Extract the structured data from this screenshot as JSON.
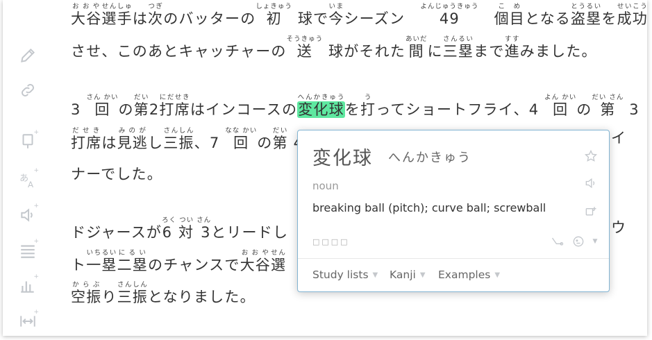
{
  "article": {
    "p1": {
      "l1": [
        {
          "t": "大谷",
          "r": "おおや"
        },
        {
          "t": "選手",
          "r": "せんしゅ"
        },
        {
          "t": "は"
        },
        {
          "t": "次",
          "r": "つぎ"
        },
        {
          "t": "のバッターの"
        },
        {
          "t": "初",
          "r": "しょきゅう"
        },
        {
          "t": " "
        },
        {
          "t": "球",
          "r": ""
        },
        {
          "t": "で"
        },
        {
          "t": "今",
          "r": "いま"
        },
        {
          "t": "シーズン　"
        },
        {
          "t": "49",
          "r": "よんじゅうきゅう"
        },
        {
          "t": "　"
        },
        {
          "t": "個",
          "r": "こ"
        },
        {
          "t": "目",
          "r": "め"
        },
        {
          "t": "となる"
        },
        {
          "t": "盗塁",
          "r": "とうるい"
        },
        {
          "t": "を"
        },
        {
          "t": "成功",
          "r": "せいこう"
        }
      ],
      "l2": [
        {
          "t": "させ、このあとキャッチャーの"
        },
        {
          "t": "送",
          "r": "そうきゅう"
        },
        {
          "t": " "
        },
        {
          "t": "球",
          "r": ""
        },
        {
          "t": "がそれた"
        },
        {
          "t": "間",
          "r": "あいだ"
        },
        {
          "t": "に"
        },
        {
          "t": "三塁",
          "r": "さんるい"
        },
        {
          "t": "まで"
        },
        {
          "t": "進",
          "r": "すす"
        },
        {
          "t": "みました。"
        }
      ]
    },
    "p2": {
      "l1": [
        {
          "t": " 3 "
        },
        {
          "t": "回",
          "r": "さん かい"
        },
        {
          "t": "の"
        },
        {
          "t": "第",
          "r": "だい"
        },
        {
          "t": "2"
        },
        {
          "t": "打席",
          "r": "にだせき"
        },
        {
          "t": "はインコースの"
        },
        {
          "t": "変化球",
          "r": "へんかきゅう",
          "hl": true
        },
        {
          "t": "を"
        },
        {
          "t": "打",
          "r": "う"
        },
        {
          "t": "ってショートフライ、4 "
        },
        {
          "t": "回",
          "r": "よん かい"
        },
        {
          "t": "の"
        },
        {
          "t": "第",
          "r": "だい さん"
        },
        {
          "t": " 3"
        }
      ],
      "l2": [
        {
          "t": "打席",
          "r": "だせき"
        },
        {
          "t": "は"
        },
        {
          "t": "見逃",
          "r": "みのが"
        },
        {
          "t": "し"
        },
        {
          "t": "三振",
          "r": "さんしん"
        },
        {
          "t": "、7 "
        },
        {
          "t": "回",
          "r": "なな かい"
        },
        {
          "t": "の"
        },
        {
          "t": "第",
          "r": "だい"
        },
        {
          "t": " 4"
        }
      ],
      "l2_tail": "イ",
      "l3": [
        {
          "t": "ナーでした。"
        }
      ]
    },
    "p3": {
      "l1": [
        {
          "t": "ドジャースが"
        },
        {
          "t": "6 対 3",
          "r": "ろく つい さん"
        },
        {
          "t": "とリードし"
        }
      ],
      "l1_tail": "ウ",
      "l2": [
        {
          "t": "ト"
        },
        {
          "t": "一塁",
          "r": "いちるい"
        },
        {
          "t": "二塁",
          "r": "にるい"
        },
        {
          "t": "のチャンスで"
        },
        {
          "t": "大谷",
          "r": "おおや"
        },
        {
          "t": "選",
          "r": "せん"
        }
      ],
      "l3": [
        {
          "t": "空振",
          "r": "からぶ"
        },
        {
          "t": "り"
        },
        {
          "t": "三振",
          "r": "さんしん"
        },
        {
          "t": "となりました。"
        }
      ]
    }
  },
  "toolbar": {
    "icons": [
      "pencil-icon",
      "link-icon",
      "flashcard-icon",
      "translate-icon",
      "speaker-icon",
      "text-lines-icon",
      "bar-chart-icon",
      "width-icon"
    ],
    "plus": "+"
  },
  "popup": {
    "word": "変化球",
    "reading": "へんかきゅう",
    "part_of_speech": "noun",
    "definition": "breaking ball (pitch); curve ball; screwball",
    "dots": "□□□□",
    "tabs": [
      "Study lists",
      "Kanji",
      "Examples"
    ],
    "caret": "▼"
  },
  "colors": {
    "highlight": "#5ee8a0",
    "popup_border": "#82b4d2",
    "icon_gray": "#c3c7cc",
    "text": "#333333"
  }
}
